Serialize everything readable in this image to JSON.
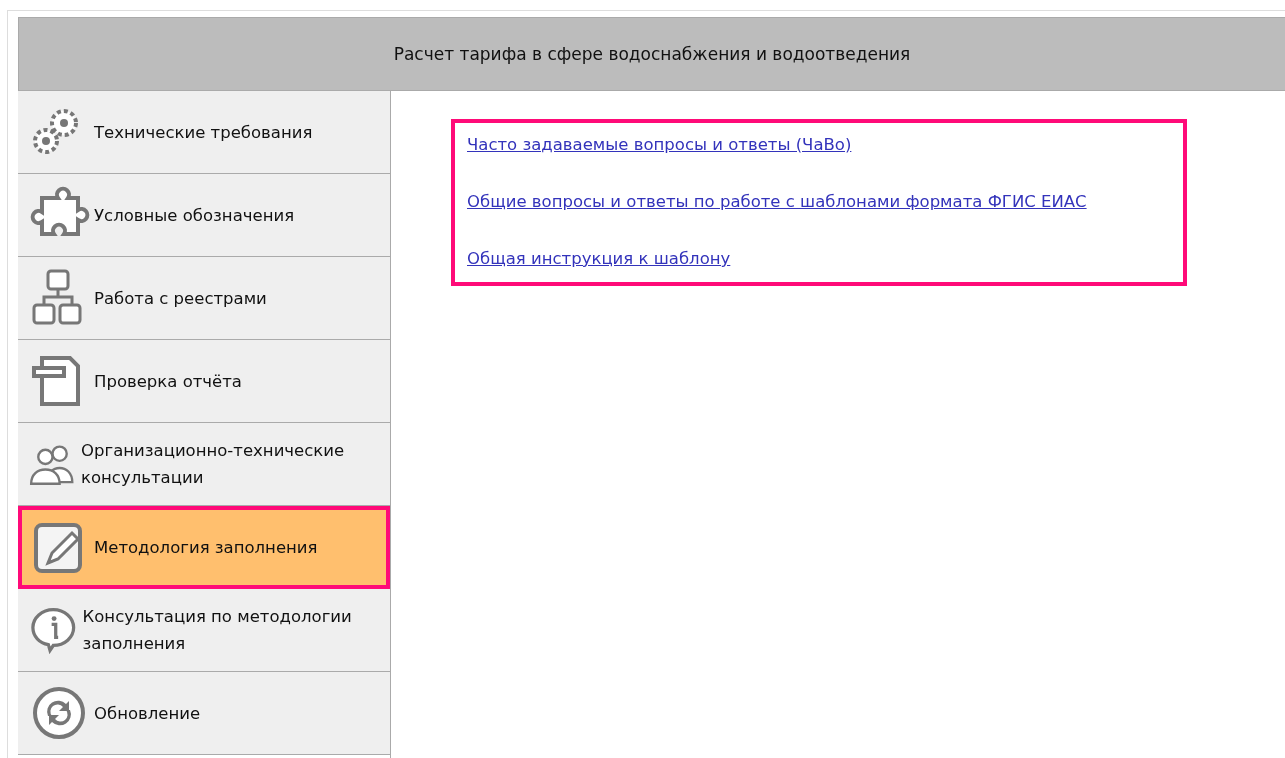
{
  "header": {
    "title": "Расчет тарифа в сфере водоснабжения и водоотведения"
  },
  "sidebar": {
    "items": [
      {
        "label": "Технические требования",
        "selected": false
      },
      {
        "label": "Условные обозначения",
        "selected": false
      },
      {
        "label": "Работа с реестрами",
        "selected": false
      },
      {
        "label": "Проверка отчёта",
        "selected": false
      },
      {
        "label": "Организационно-технические консультации",
        "selected": false
      },
      {
        "label": "Методология заполнения",
        "selected": true
      },
      {
        "label": "Консультация по методологии заполнения",
        "selected": false
      },
      {
        "label": "Обновление",
        "selected": false
      }
    ]
  },
  "links": [
    "Часто задаваемые вопросы и ответы (ЧаВо)",
    "Общие вопросы и ответы по работе с шаблонами формата ФГИС ЕИАС",
    "Общая инструкция к шаблону"
  ]
}
